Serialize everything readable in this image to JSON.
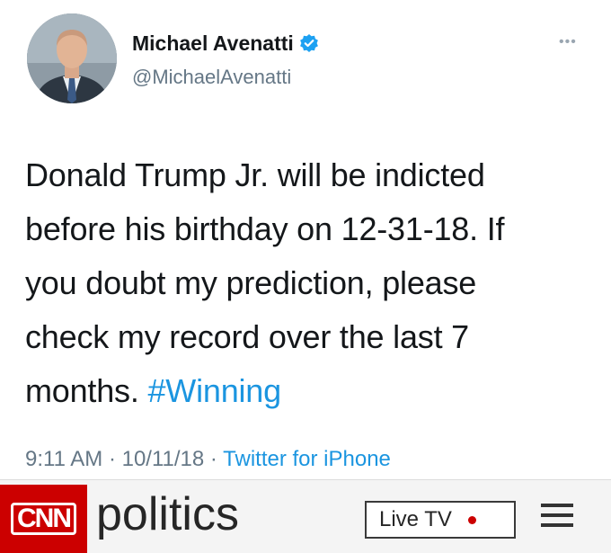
{
  "tweet": {
    "name": "Michael Avenatti",
    "handle": "@MichaelAvenatti",
    "more": "•••",
    "text_lines": [
      "Donald Trump Jr. will be indicted",
      "before his birthday on 12-31-18. If",
      "you doubt my prediction, please",
      "check my record over the last 7",
      "months. "
    ],
    "hashtag": "#Winning",
    "time": "9:11 AM",
    "date": "10/11/18",
    "source": "Twitter for iPhone",
    "separator": " · ",
    "verified_color": "#1da1f2",
    "link_color": "#1b95e0"
  },
  "cnn": {
    "logo": "CNN",
    "section": "politics",
    "live_tv_label": "Live TV",
    "brand_color": "#cc0000",
    "menu_icon": "hamburger-menu-icon"
  }
}
